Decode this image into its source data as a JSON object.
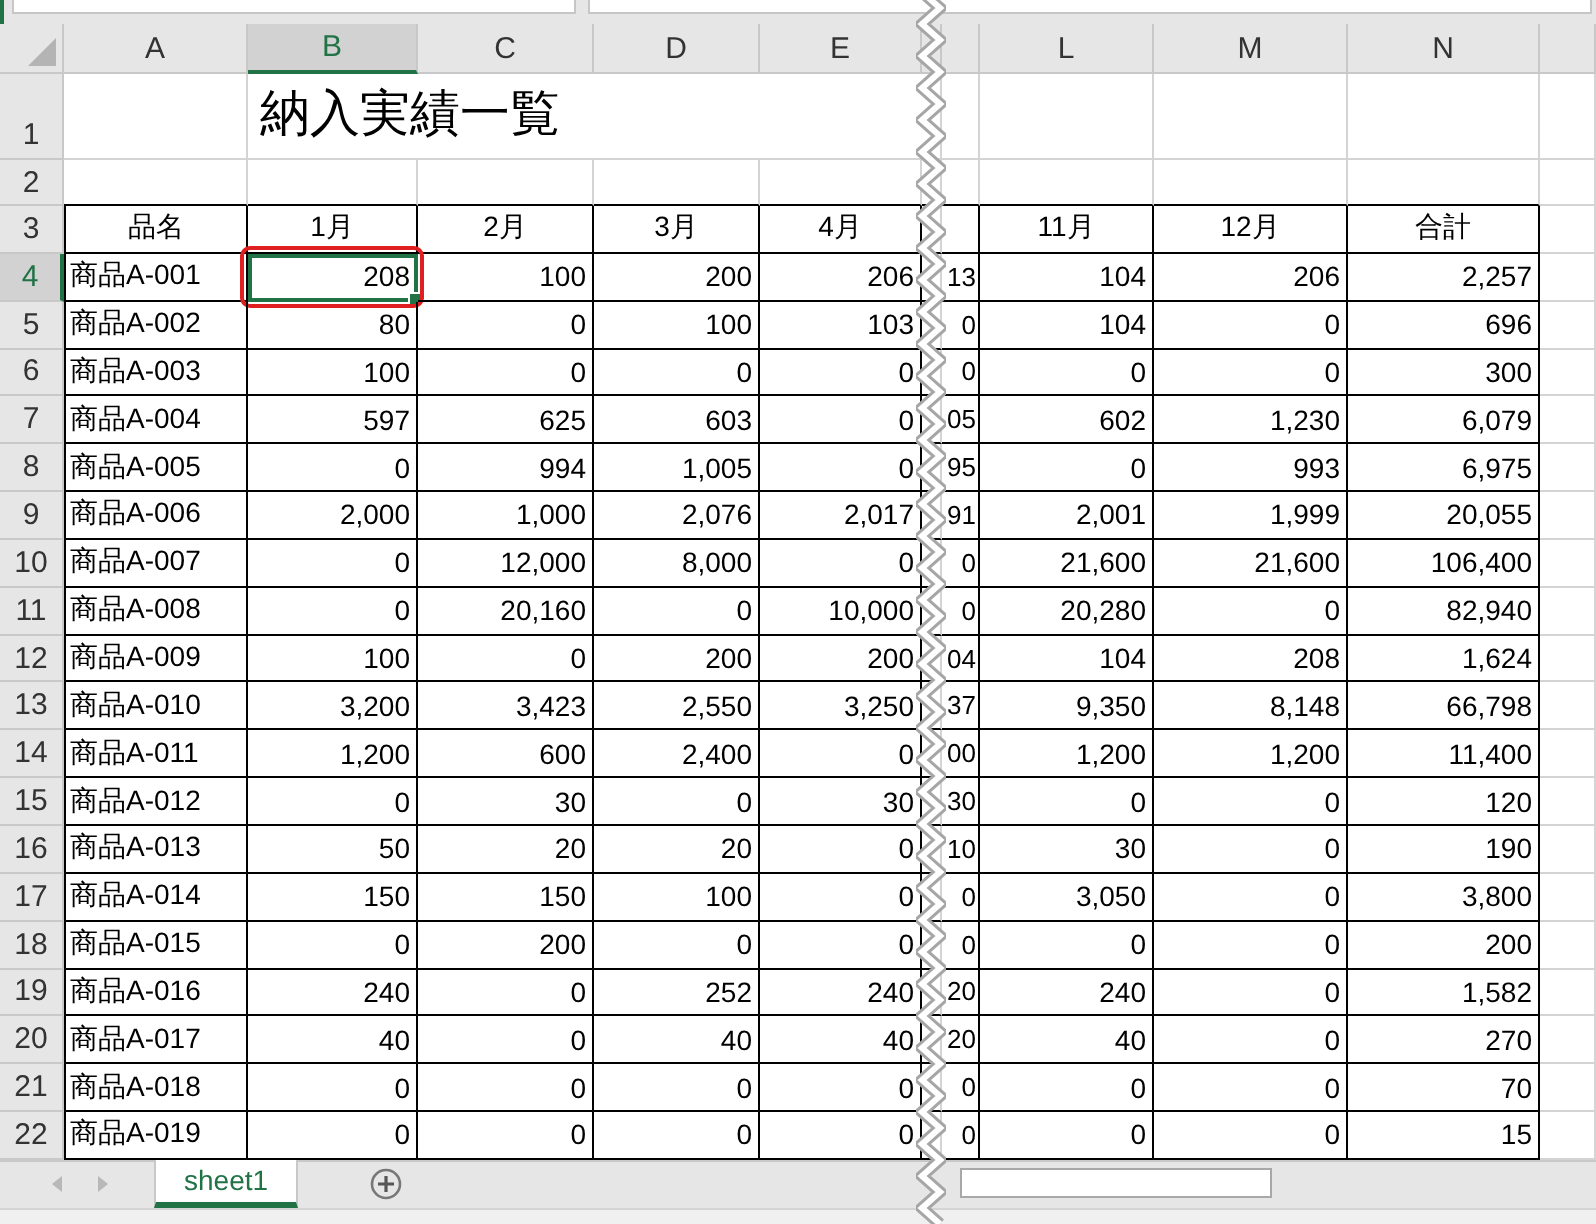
{
  "columns": [
    {
      "label": "A",
      "selected": false
    },
    {
      "label": "B",
      "selected": true
    },
    {
      "label": "C",
      "selected": false
    },
    {
      "label": "D",
      "selected": false
    },
    {
      "label": "E",
      "selected": false
    },
    {
      "label": "L",
      "selected": false
    },
    {
      "label": "M",
      "selected": false
    },
    {
      "label": "N",
      "selected": false
    }
  ],
  "row_headers": [
    {
      "label": "1",
      "selected": false
    },
    {
      "label": "2",
      "selected": false
    },
    {
      "label": "3",
      "selected": false
    },
    {
      "label": "4",
      "selected": true
    },
    {
      "label": "5",
      "selected": false
    },
    {
      "label": "6",
      "selected": false
    },
    {
      "label": "7",
      "selected": false
    },
    {
      "label": "8",
      "selected": false
    },
    {
      "label": "9",
      "selected": false
    },
    {
      "label": "10",
      "selected": false
    },
    {
      "label": "11",
      "selected": false
    },
    {
      "label": "12",
      "selected": false
    },
    {
      "label": "13",
      "selected": false
    },
    {
      "label": "14",
      "selected": false
    },
    {
      "label": "15",
      "selected": false
    },
    {
      "label": "16",
      "selected": false
    },
    {
      "label": "17",
      "selected": false
    },
    {
      "label": "18",
      "selected": false
    },
    {
      "label": "19",
      "selected": false
    },
    {
      "label": "20",
      "selected": false
    },
    {
      "label": "21",
      "selected": false
    },
    {
      "label": "22",
      "selected": false
    }
  ],
  "title": "納入実績一覧",
  "header_labels": [
    "品名",
    "1月",
    "2月",
    "3月",
    "4月",
    "11月",
    "12月",
    "合計"
  ],
  "rows": [
    {
      "name": "商品A-001",
      "values": [
        "208",
        "100",
        "200",
        "206",
        "104",
        "206",
        "2,257"
      ],
      "cut_value": "13"
    },
    {
      "name": "商品A-002",
      "values": [
        "80",
        "0",
        "100",
        "103",
        "104",
        "0",
        "696"
      ],
      "cut_value": "0"
    },
    {
      "name": "商品A-003",
      "values": [
        "100",
        "0",
        "0",
        "0",
        "0",
        "0",
        "300"
      ],
      "cut_value": "0"
    },
    {
      "name": "商品A-004",
      "values": [
        "597",
        "625",
        "603",
        "0",
        "602",
        "1,230",
        "6,079"
      ],
      "cut_value": "05"
    },
    {
      "name": "商品A-005",
      "values": [
        "0",
        "994",
        "1,005",
        "0",
        "0",
        "993",
        "6,975"
      ],
      "cut_value": "95"
    },
    {
      "name": "商品A-006",
      "values": [
        "2,000",
        "1,000",
        "2,076",
        "2,017",
        "2,001",
        "1,999",
        "20,055"
      ],
      "cut_value": "91"
    },
    {
      "name": "商品A-007",
      "values": [
        "0",
        "12,000",
        "8,000",
        "0",
        "21,600",
        "21,600",
        "106,400"
      ],
      "cut_value": "0"
    },
    {
      "name": "商品A-008",
      "values": [
        "0",
        "20,160",
        "0",
        "10,000",
        "20,280",
        "0",
        "82,940"
      ],
      "cut_value": "0"
    },
    {
      "name": "商品A-009",
      "values": [
        "100",
        "0",
        "200",
        "200",
        "104",
        "208",
        "1,624"
      ],
      "cut_value": "04"
    },
    {
      "name": "商品A-010",
      "values": [
        "3,200",
        "3,423",
        "2,550",
        "3,250",
        "9,350",
        "8,148",
        "66,798"
      ],
      "cut_value": "37"
    },
    {
      "name": "商品A-011",
      "values": [
        "1,200",
        "600",
        "2,400",
        "0",
        "1,200",
        "1,200",
        "11,400"
      ],
      "cut_value": "00"
    },
    {
      "name": "商品A-012",
      "values": [
        "0",
        "30",
        "0",
        "30",
        "0",
        "0",
        "120"
      ],
      "cut_value": "30"
    },
    {
      "name": "商品A-013",
      "values": [
        "50",
        "20",
        "20",
        "0",
        "30",
        "0",
        "190"
      ],
      "cut_value": "10"
    },
    {
      "name": "商品A-014",
      "values": [
        "150",
        "150",
        "100",
        "0",
        "3,050",
        "0",
        "3,800"
      ],
      "cut_value": "0"
    },
    {
      "name": "商品A-015",
      "values": [
        "0",
        "200",
        "0",
        "0",
        "0",
        "0",
        "200"
      ],
      "cut_value": "0"
    },
    {
      "name": "商品A-016",
      "values": [
        "240",
        "0",
        "252",
        "240",
        "240",
        "0",
        "1,582"
      ],
      "cut_value": "20"
    },
    {
      "name": "商品A-017",
      "values": [
        "40",
        "0",
        "40",
        "40",
        "40",
        "0",
        "270"
      ],
      "cut_value": "20"
    },
    {
      "name": "商品A-018",
      "values": [
        "0",
        "0",
        "0",
        "0",
        "0",
        "0",
        "70"
      ],
      "cut_value": "0"
    },
    {
      "name": "商品A-019",
      "values": [
        "0",
        "0",
        "0",
        "0",
        "0",
        "0",
        "15"
      ],
      "cut_value": "0"
    }
  ],
  "highlight_frame": true,
  "sheet_tabs": [
    {
      "label": "sheet1",
      "selected": true
    }
  ]
}
